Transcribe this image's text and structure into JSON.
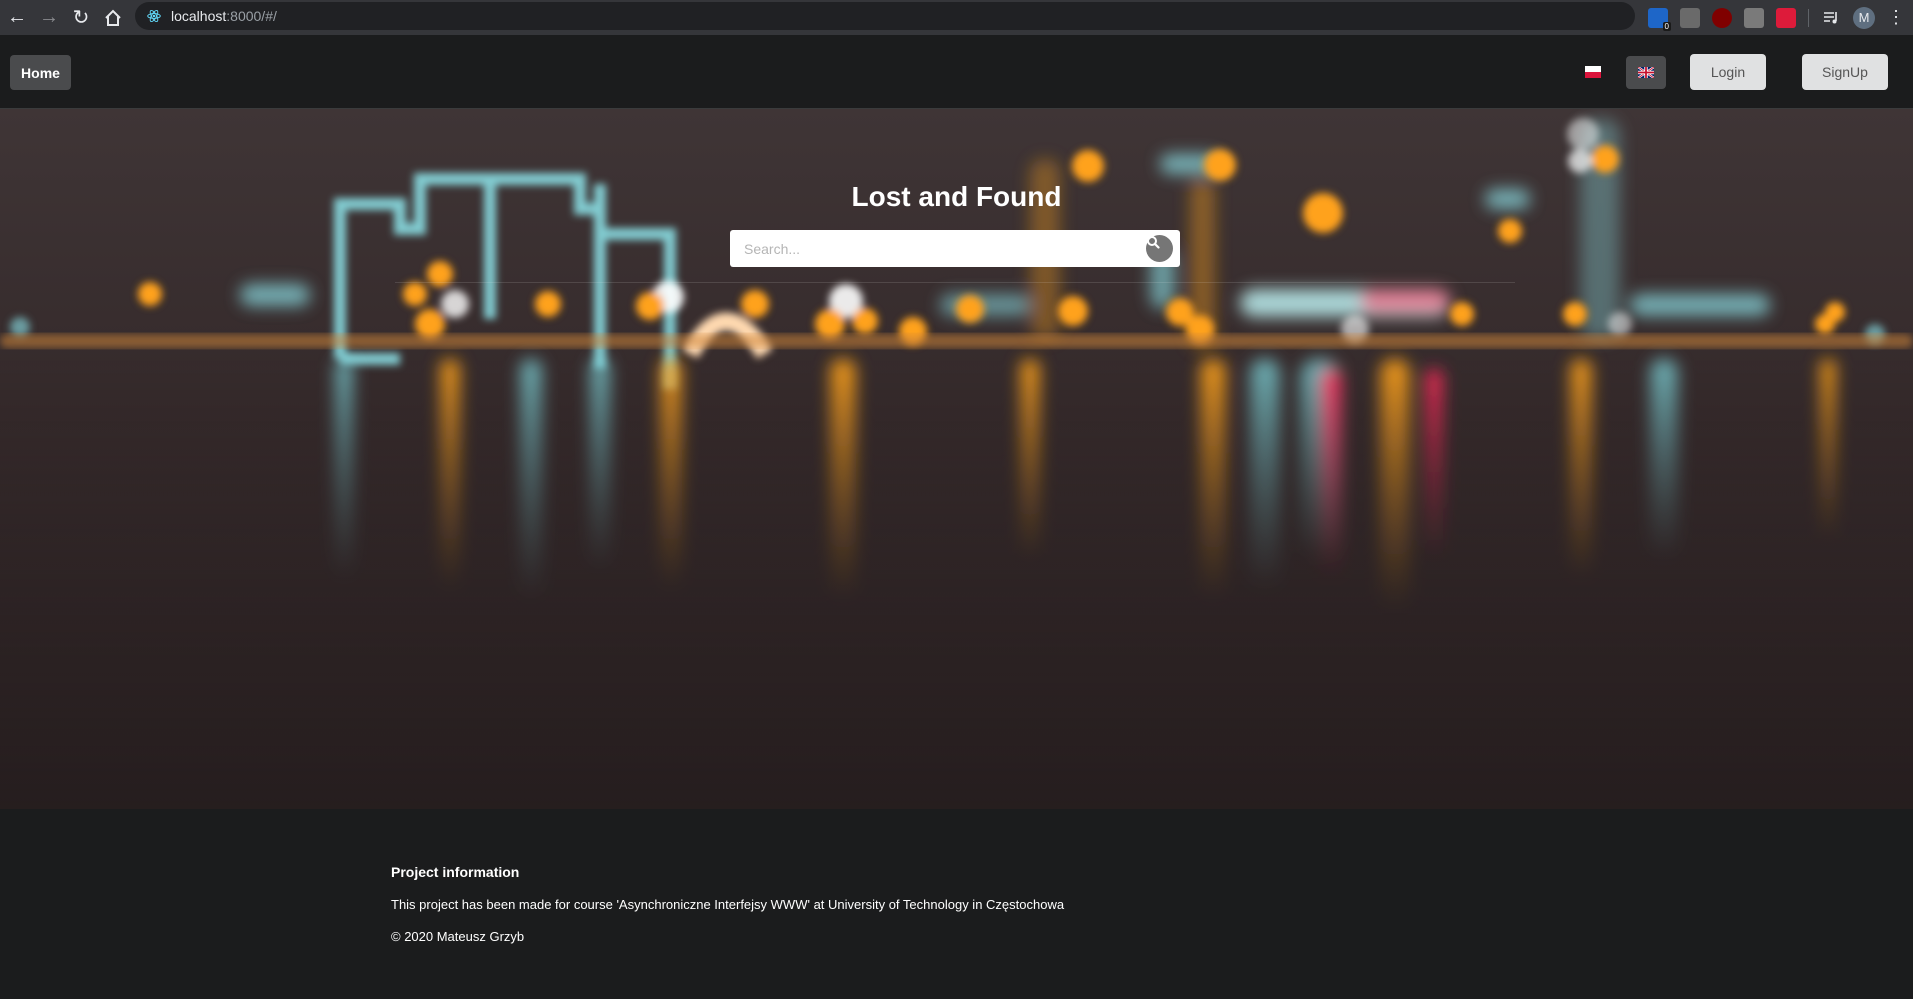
{
  "browser": {
    "url_host": "localhost",
    "url_rest": ":8000/#/",
    "profile_initial": "M",
    "extension_badge": "0"
  },
  "navbar": {
    "home_label": "Home",
    "login_label": "Login",
    "signup_label": "SignUp"
  },
  "hero": {
    "title": "Lost and Found",
    "search_placeholder": "Search...",
    "search_value": ""
  },
  "footer": {
    "heading": "Project information",
    "description": "This project has been made for course 'Asynchroniczne Interfejsy WWW' at University of Technology in Częstochowa",
    "copyright": "© 2020 Mateusz Grzyb"
  },
  "colors": {
    "page_bg": "#1b1c1d",
    "button_dark": "#4a4b4d",
    "button_light": "#e0e1e2",
    "bokeh_orange": "#ffa21a",
    "bokeh_cyan": "#8ee6ec",
    "bokeh_red": "#ff2a4a"
  }
}
